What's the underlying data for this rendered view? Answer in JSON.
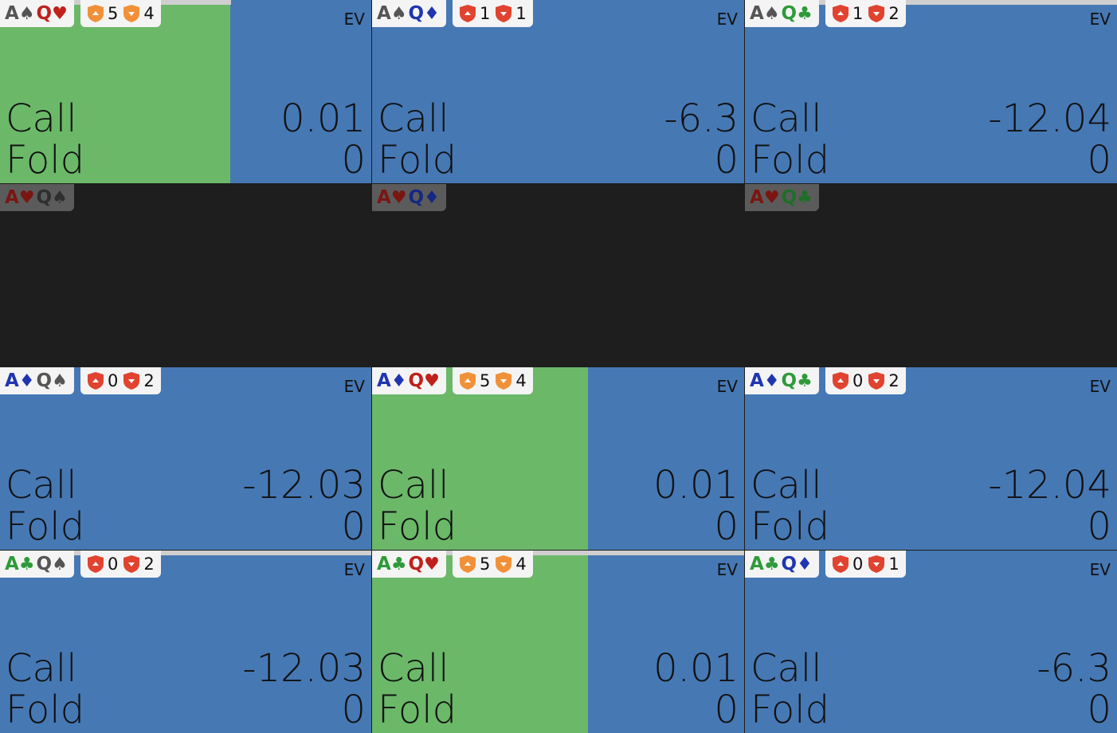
{
  "ev_label": "EV",
  "actions": {
    "call": "Call",
    "fold": "Fold"
  },
  "colors": {
    "cell_blue": "#4678b4",
    "call_green": "#6bb869",
    "empty_dark": "#1e1e1e",
    "shield_orange": "#f0913a",
    "shield_red": "#e0432f"
  },
  "cells": [
    {
      "hand": [
        {
          "rank": "A",
          "suit": "♠",
          "color": "black"
        },
        {
          "rank": "Q",
          "suit": "♥",
          "color": "red"
        }
      ],
      "badge": [
        {
          "shield": "orange-up",
          "value": "5"
        },
        {
          "shield": "orange-down",
          "value": "4"
        }
      ],
      "call_ev": "0.01",
      "fold_ev": "0",
      "call_fraction": 0.62,
      "empty": false
    },
    {
      "hand": [
        {
          "rank": "A",
          "suit": "♠",
          "color": "black"
        },
        {
          "rank": "Q",
          "suit": "♦",
          "color": "blue"
        }
      ],
      "badge": [
        {
          "shield": "red-up",
          "value": "1"
        },
        {
          "shield": "red-down",
          "value": "1"
        }
      ],
      "call_ev": "-6.3",
      "fold_ev": "0",
      "call_fraction": 0,
      "empty": false
    },
    {
      "hand": [
        {
          "rank": "A",
          "suit": "♠",
          "color": "black"
        },
        {
          "rank": "Q",
          "suit": "♣",
          "color": "green"
        }
      ],
      "badge": [
        {
          "shield": "red-up",
          "value": "1"
        },
        {
          "shield": "red-down",
          "value": "2"
        }
      ],
      "call_ev": "-12.04",
      "fold_ev": "0",
      "call_fraction": 0,
      "empty": false
    },
    {
      "hand": [
        {
          "rank": "A",
          "suit": "♥",
          "color": "red"
        },
        {
          "rank": "Q",
          "suit": "♠",
          "color": "black"
        }
      ],
      "empty": true
    },
    {
      "hand": [
        {
          "rank": "A",
          "suit": "♥",
          "color": "red"
        },
        {
          "rank": "Q",
          "suit": "♦",
          "color": "blue"
        }
      ],
      "empty": true
    },
    {
      "hand": [
        {
          "rank": "A",
          "suit": "♥",
          "color": "red"
        },
        {
          "rank": "Q",
          "suit": "♣",
          "color": "green"
        }
      ],
      "empty": true
    },
    {
      "hand": [
        {
          "rank": "A",
          "suit": "♦",
          "color": "blue"
        },
        {
          "rank": "Q",
          "suit": "♠",
          "color": "black"
        }
      ],
      "badge": [
        {
          "shield": "red-up",
          "value": "0"
        },
        {
          "shield": "red-down",
          "value": "2"
        }
      ],
      "call_ev": "-12.03",
      "fold_ev": "0",
      "call_fraction": 0,
      "empty": false
    },
    {
      "hand": [
        {
          "rank": "A",
          "suit": "♦",
          "color": "blue"
        },
        {
          "rank": "Q",
          "suit": "♥",
          "color": "red"
        }
      ],
      "badge": [
        {
          "shield": "orange-up",
          "value": "5"
        },
        {
          "shield": "orange-down",
          "value": "4"
        }
      ],
      "call_ev": "0.01",
      "fold_ev": "0",
      "call_fraction": 0.58,
      "empty": false
    },
    {
      "hand": [
        {
          "rank": "A",
          "suit": "♦",
          "color": "blue"
        },
        {
          "rank": "Q",
          "suit": "♣",
          "color": "green"
        }
      ],
      "badge": [
        {
          "shield": "red-up",
          "value": "0"
        },
        {
          "shield": "red-down",
          "value": "2"
        }
      ],
      "call_ev": "-12.04",
      "fold_ev": "0",
      "call_fraction": 0,
      "empty": false
    },
    {
      "hand": [
        {
          "rank": "A",
          "suit": "♣",
          "color": "green"
        },
        {
          "rank": "Q",
          "suit": "♠",
          "color": "black"
        }
      ],
      "badge": [
        {
          "shield": "red-up",
          "value": "0"
        },
        {
          "shield": "red-down",
          "value": "2"
        }
      ],
      "call_ev": "-12.03",
      "fold_ev": "0",
      "call_fraction": 0,
      "empty": false
    },
    {
      "hand": [
        {
          "rank": "A",
          "suit": "♣",
          "color": "green"
        },
        {
          "rank": "Q",
          "suit": "♥",
          "color": "red"
        }
      ],
      "badge": [
        {
          "shield": "orange-up",
          "value": "5"
        },
        {
          "shield": "orange-down",
          "value": "4"
        }
      ],
      "call_ev": "0.01",
      "fold_ev": "0",
      "call_fraction": 0.58,
      "empty": false
    },
    {
      "hand": [
        {
          "rank": "A",
          "suit": "♣",
          "color": "green"
        },
        {
          "rank": "Q",
          "suit": "♦",
          "color": "blue"
        }
      ],
      "badge": [
        {
          "shield": "red-up",
          "value": "0"
        },
        {
          "shield": "red-down",
          "value": "1"
        }
      ],
      "call_ev": "-6.3",
      "fold_ev": "0",
      "call_fraction": 0,
      "empty": false
    }
  ]
}
